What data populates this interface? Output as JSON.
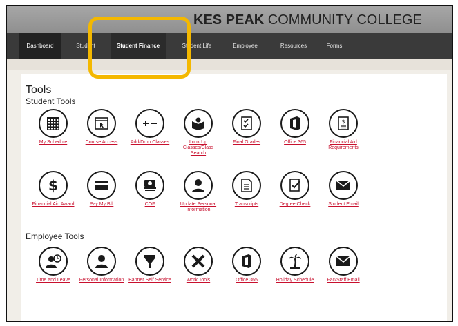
{
  "banner": {
    "brand_bold": "KES PEAK",
    "brand_rest": " COMMUNITY COLLEGE"
  },
  "nav": [
    "Dashboard",
    "Student",
    "Student Finance",
    "Student Life",
    "Employee",
    "Resources",
    "Forms"
  ],
  "page": {
    "title": "Tools",
    "student_tools_heading": "Student Tools",
    "employee_tools_heading": "Employee Tools"
  },
  "student_tools_row1": [
    {
      "label": "My Schedule",
      "icon": "calendar-icon"
    },
    {
      "label": "Course Access",
      "icon": "cursor-window-icon"
    },
    {
      "label": "Add/Drop Classes",
      "icon": "plus-minus-icon"
    },
    {
      "label": "Look Up Classes/Class Search",
      "icon": "open-book-icon"
    },
    {
      "label": "Final Grades",
      "icon": "checklist-icon"
    },
    {
      "label": "Office 365",
      "icon": "office-icon"
    },
    {
      "label": "Financial Aid Requirements",
      "icon": "dollar-document-icon"
    }
  ],
  "student_tools_row2": [
    {
      "label": "Financial Aid Award",
      "icon": "dollar-icon"
    },
    {
      "label": "Pay My Bill",
      "icon": "credit-card-icon"
    },
    {
      "label": "COF",
      "icon": "cash-icon"
    },
    {
      "label": "Update Personal Information",
      "icon": "person-icon"
    },
    {
      "label": "Transcripts",
      "icon": "document-icon"
    },
    {
      "label": "Degree Check",
      "icon": "check-document-icon"
    },
    {
      "label": "Student Email",
      "icon": "envelope-icon"
    }
  ],
  "employee_tools": [
    {
      "label": "Time and Leave",
      "icon": "person-clock-icon"
    },
    {
      "label": "Personal Information",
      "icon": "person-icon"
    },
    {
      "label": "Banner Self Service",
      "icon": "banner-icon"
    },
    {
      "label": "Work Tools",
      "icon": "tools-icon"
    },
    {
      "label": "Office 365",
      "icon": "office-icon"
    },
    {
      "label": "Holiday Schedule",
      "icon": "palm-tree-icon"
    },
    {
      "label": "Fac/Staff Email",
      "icon": "envelope-icon"
    }
  ]
}
